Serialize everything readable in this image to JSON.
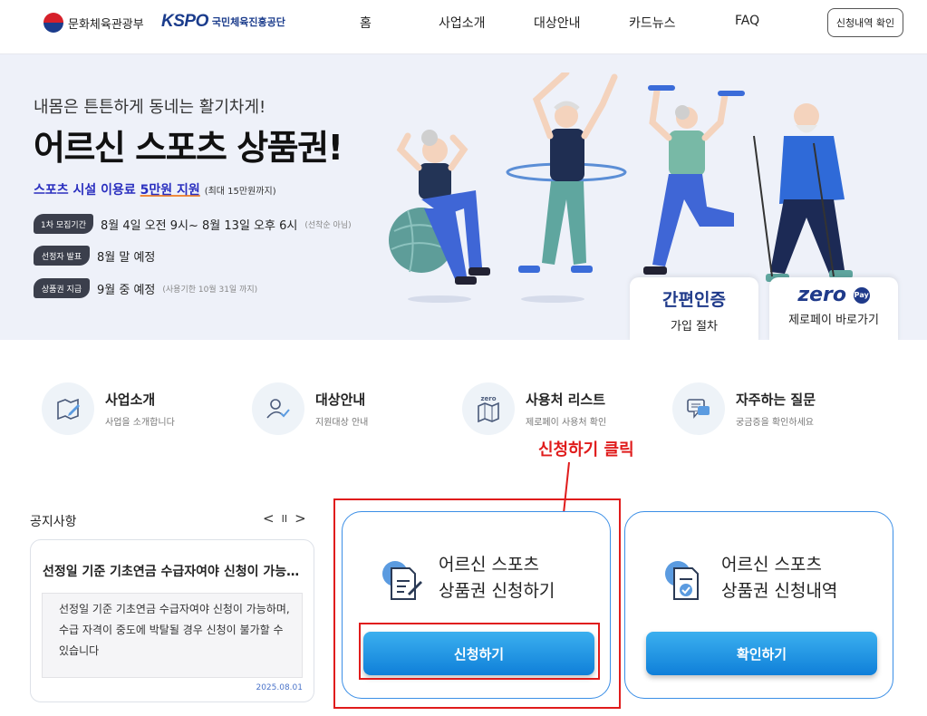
{
  "header": {
    "ministry": "문화체육관광부",
    "kspo_brand": "KSPO",
    "kspo_name": "국민체육진흥공단",
    "nav": [
      "홈",
      "사업소개",
      "대상안내",
      "카드뉴스",
      "FAQ"
    ],
    "apply_check": "신청내역 확인"
  },
  "banner": {
    "slogan": "내몸은 튼튼하게 동네는 활기차게!",
    "title": "어르신 스포츠 상품권!",
    "sub_a": "스포츠 시설 이용료 ",
    "sub_b": "5만원 지원",
    "sub_note": "(최대 15만원까지)",
    "schedule": [
      {
        "tag": "1차 모집기간",
        "text": "8월 4일 오전 9시~ 8월 13일 오후 6시",
        "note": "(선착순 아님)"
      },
      {
        "tag": "선정자 발표",
        "text": "8월 말 예정",
        "note": ""
      },
      {
        "tag": "상품권 지급",
        "text": "9월 중 예정",
        "note": "(사용기한 10월 31일 까지)"
      }
    ],
    "quick": [
      {
        "brand": "간편인증",
        "label": "가입 절차"
      },
      {
        "brand": "zero",
        "badge": "Pay",
        "label": "제로페이 바로가기"
      }
    ]
  },
  "menu": [
    {
      "title": "사업소개",
      "sub": "사업을 소개합니다",
      "icon": "map-pen-icon"
    },
    {
      "title": "대상안내",
      "sub": "지원대상 안내",
      "icon": "user-check-icon"
    },
    {
      "title": "사용처 리스트",
      "sub": "제로페이 사용처 확인",
      "icon": "zero-map-icon",
      "icon_text": "zero"
    },
    {
      "title": "자주하는 질문",
      "sub": "궁금증을 확인하세요",
      "icon": "chat-bubbles-icon"
    }
  ],
  "annotation": {
    "text": "신청하기 클릭",
    "color": "#e01c1c"
  },
  "notice": {
    "heading": "공지사항",
    "prev": "<",
    "pause": "II",
    "next": ">",
    "title": "선정일 기준 기초연금 수급자여야 신청이 가능하며, 수급 자격이 중도에 박탈될 경우 신청이 불가할 수 있습니다",
    "body": "선정일 기준 기초연금 수급자여야 신청이 가능하며, 수급 자격이 중도에 박탈될 경우 신청이 불가할 수 있습니다",
    "date": "2025.08.01"
  },
  "cards": [
    {
      "line1": "어르신 스포츠",
      "line2": "상품권 신청하기",
      "button": "신청하기",
      "icon": "document-pen-icon"
    },
    {
      "line1": "어르신 스포츠",
      "line2": "상품권 신청내역",
      "button": "확인하기",
      "icon": "document-check-icon"
    }
  ],
  "colors": {
    "primary_blue": "#1f8ae6",
    "annotation_red": "#e01c1c",
    "navy": "#1b3c8c"
  }
}
